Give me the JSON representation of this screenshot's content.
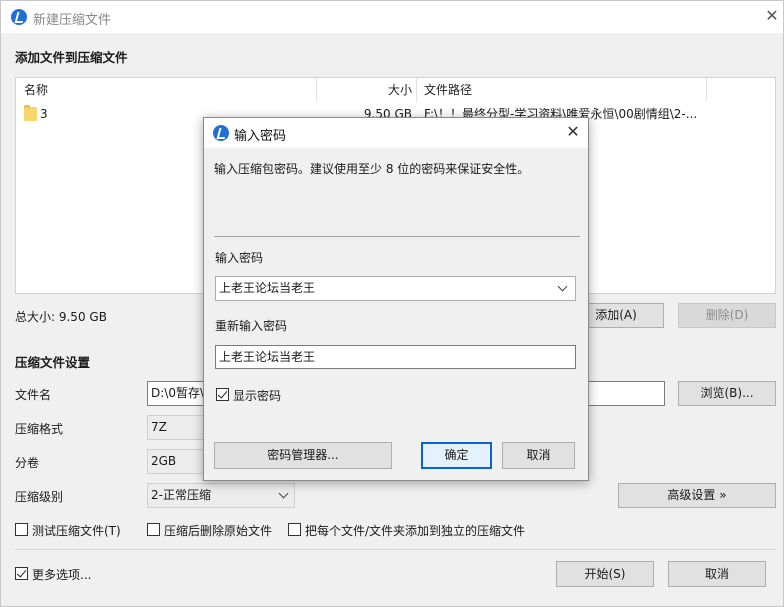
{
  "window": {
    "title": "新建压缩文件",
    "close_glyph": "✕"
  },
  "add_section": {
    "title": "添加文件到压缩文件",
    "columns": {
      "name": "名称",
      "size": "大小",
      "path": "文件路径"
    },
    "rows": [
      {
        "name": "3",
        "size": "9.50 GB",
        "path": "F:\\！！最终分型-学习资料\\唯爱永恒\\00剧情组\\2-..."
      }
    ],
    "total_size": "总大小: 9.50 GB",
    "add_button": "添加(A)",
    "delete_button": "删除(D)"
  },
  "settings": {
    "title": "压缩文件设置",
    "filename_label": "文件名",
    "filename_value": "D:\\0暂存\\",
    "browse_button": "浏览(B)...",
    "format_label": "压缩格式",
    "format_value": "7Z",
    "split_label": "分卷",
    "split_value": "2GB",
    "level_label": "压缩级别",
    "level_value": "2-正常压缩",
    "advanced_button": "高级设置 »",
    "test_label": "测试压缩文件(T)",
    "delete_after_label": "压缩后删除原始文件",
    "separate_label": "把每个文件/文件夹添加到独立的压缩文件",
    "more_options_label": "更多选项...",
    "start_button": "开始(S)",
    "cancel_button": "取消"
  },
  "dialog": {
    "title": "输入密码",
    "close_glyph": "✕",
    "description": "输入压缩包密码。建议使用至少 8 位的密码来保证安全性。",
    "password_label": "输入密码",
    "password_value": "上老王论坛当老王",
    "reenter_label": "重新输入密码",
    "reenter_value": "上老王论坛当老王",
    "show_password_label": "显示密码",
    "manager_button": "密码管理器...",
    "ok_button": "确定",
    "cancel_button": "取消"
  },
  "colors": {
    "accent": "#0a64d6",
    "app_icon": "#1f6fd6",
    "folder": "#f5d76e"
  },
  "icons": {
    "app": "bandizip-icon",
    "folder": "folder-icon",
    "close": "close-icon",
    "dropdown": "chevron-down-icon"
  }
}
